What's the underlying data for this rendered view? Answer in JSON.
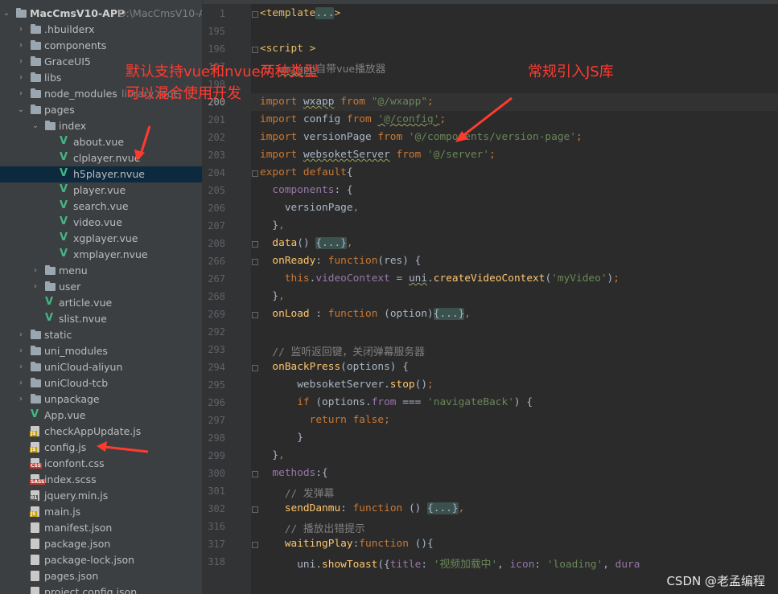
{
  "project": {
    "name": "MacCmsV10-APP",
    "path": "D:\\MacCmsV10-A"
  },
  "tree": [
    {
      "label": "MacCmsV10-APP",
      "type": "root",
      "depth": 0,
      "expanded": true,
      "hint": "D:\\MacCmsV10-A"
    },
    {
      "label": ".hbuilderx",
      "type": "folder",
      "depth": 1,
      "expanded": false
    },
    {
      "label": "components",
      "type": "folder",
      "depth": 1,
      "expanded": false
    },
    {
      "label": "GraceUI5",
      "type": "folder",
      "depth": 1,
      "expanded": false
    },
    {
      "label": "libs",
      "type": "folder",
      "depth": 1,
      "expanded": false
    },
    {
      "label": "node_modules",
      "type": "folder",
      "depth": 1,
      "expanded": false,
      "hint": "library root"
    },
    {
      "label": "pages",
      "type": "folder",
      "depth": 1,
      "expanded": true
    },
    {
      "label": "index",
      "type": "folder",
      "depth": 2,
      "expanded": true
    },
    {
      "label": "about.vue",
      "type": "vue",
      "depth": 3
    },
    {
      "label": "clplayer.nvue",
      "type": "vue",
      "depth": 3
    },
    {
      "label": "h5player.nvue",
      "type": "vue",
      "depth": 3,
      "selected": true
    },
    {
      "label": "player.vue",
      "type": "vue",
      "depth": 3
    },
    {
      "label": "search.vue",
      "type": "vue",
      "depth": 3
    },
    {
      "label": "video.vue",
      "type": "vue",
      "depth": 3
    },
    {
      "label": "xgplayer.vue",
      "type": "vue",
      "depth": 3
    },
    {
      "label": "xmplayer.nvue",
      "type": "vue",
      "depth": 3
    },
    {
      "label": "menu",
      "type": "folder",
      "depth": 2,
      "expanded": false
    },
    {
      "label": "user",
      "type": "folder",
      "depth": 2,
      "expanded": false
    },
    {
      "label": "article.vue",
      "type": "vue",
      "depth": 2
    },
    {
      "label": "slist.nvue",
      "type": "vue",
      "depth": 2
    },
    {
      "label": "static",
      "type": "folder",
      "depth": 1,
      "expanded": false
    },
    {
      "label": "uni_modules",
      "type": "folder",
      "depth": 1,
      "expanded": false
    },
    {
      "label": "uniCloud-aliyun",
      "type": "folder",
      "depth": 1,
      "expanded": false
    },
    {
      "label": "uniCloud-tcb",
      "type": "folder",
      "depth": 1,
      "expanded": false
    },
    {
      "label": "unpackage",
      "type": "folder",
      "depth": 1,
      "expanded": false
    },
    {
      "label": "App.vue",
      "type": "vue",
      "depth": 1
    },
    {
      "label": "checkAppUpdate.js",
      "type": "js",
      "depth": 1
    },
    {
      "label": "config.js",
      "type": "js",
      "depth": 1
    },
    {
      "label": "iconfont.css",
      "type": "css",
      "depth": 1
    },
    {
      "label": "index.scss",
      "type": "sass",
      "depth": 1
    },
    {
      "label": "jquery.min.js",
      "type": "bin",
      "depth": 1
    },
    {
      "label": "main.js",
      "type": "js",
      "depth": 1
    },
    {
      "label": "manifest.json",
      "type": "json",
      "depth": 1
    },
    {
      "label": "package.json",
      "type": "json",
      "depth": 1
    },
    {
      "label": "package-lock.json",
      "type": "json",
      "depth": 1
    },
    {
      "label": "pages.json",
      "type": "json",
      "depth": 1
    },
    {
      "label": "project.config.json",
      "type": "json",
      "depth": 1
    }
  ],
  "editor": {
    "current_line": "200",
    "lines": [
      {
        "n": "1",
        "fold": true,
        "segs": [
          [
            "tag",
            "<template"
          ],
          [
            "fold-text",
            "..."
          ],
          [
            "tag",
            ">"
          ]
        ]
      },
      {
        "n": "195",
        "segs": []
      },
      {
        "n": "196",
        "fold": true,
        "segs": [
          [
            "tag",
            "<script "
          ],
          [
            "tag",
            ">"
          ]
        ]
      },
      {
        "n": "197",
        "segs": [
          [
            "cm",
            "// "
          ],
          [
            "cm squig",
            "uniapp"
          ],
          [
            "cm",
            "自带vue播放器"
          ]
        ]
      },
      {
        "n": "198",
        "segs": []
      },
      {
        "n": "200",
        "segs": [
          [
            "kw",
            "import "
          ],
          [
            "plain squig",
            "wxapp"
          ],
          [
            "kw",
            " from "
          ],
          [
            "str",
            "\"@/wxapp\""
          ],
          [
            "kw",
            ";"
          ]
        ]
      },
      {
        "n": "201",
        "segs": [
          [
            "kw",
            "import "
          ],
          [
            "plain",
            "config"
          ],
          [
            "kw",
            " from "
          ],
          [
            "str squig",
            "'@/config'"
          ],
          [
            "kw",
            ";"
          ]
        ]
      },
      {
        "n": "202",
        "segs": [
          [
            "kw",
            "import "
          ],
          [
            "plain",
            "versionPage"
          ],
          [
            "kw",
            " from "
          ],
          [
            "str",
            "'@/components/version-page'"
          ],
          [
            "kw",
            ";"
          ]
        ]
      },
      {
        "n": "203",
        "segs": [
          [
            "kw",
            "import "
          ],
          [
            "plain squig",
            "websoketServer"
          ],
          [
            "kw",
            " from "
          ],
          [
            "str",
            "'@/server'"
          ],
          [
            "kw",
            ";"
          ]
        ]
      },
      {
        "n": "204",
        "fold": true,
        "segs": [
          [
            "kw",
            "export default"
          ],
          [
            "plain",
            "{"
          ]
        ]
      },
      {
        "n": "205",
        "segs": [
          [
            "prop",
            "  components"
          ],
          [
            "plain",
            ": {"
          ]
        ]
      },
      {
        "n": "206",
        "segs": [
          [
            "plain",
            "    versionPage"
          ],
          [
            "kw",
            ","
          ]
        ]
      },
      {
        "n": "207",
        "segs": [
          [
            "plain",
            "  }"
          ],
          [
            "kw",
            ","
          ]
        ]
      },
      {
        "n": "208",
        "fold": true,
        "segs": [
          [
            "fn",
            "  data"
          ],
          [
            "plain",
            "() "
          ],
          [
            "fold-text",
            "{...}"
          ],
          [
            "kw",
            ","
          ]
        ]
      },
      {
        "n": "266",
        "fold": true,
        "segs": [
          [
            "fn",
            "  onReady"
          ],
          [
            "plain",
            ": "
          ],
          [
            "kw",
            "function"
          ],
          [
            "plain",
            "(res) {"
          ]
        ]
      },
      {
        "n": "267",
        "segs": [
          [
            "kw",
            "    this"
          ],
          [
            "plain",
            "."
          ],
          [
            "prop",
            "videoContext"
          ],
          [
            "plain",
            " = "
          ],
          [
            "plain squig",
            "uni"
          ],
          [
            "plain",
            "."
          ],
          [
            "fn",
            "createVideoContext"
          ],
          [
            "plain",
            "("
          ],
          [
            "str",
            "'myVideo'"
          ],
          [
            "plain",
            ")"
          ],
          [
            "kw",
            ";"
          ]
        ]
      },
      {
        "n": "268",
        "segs": [
          [
            "plain",
            "  }"
          ],
          [
            "kw",
            ","
          ]
        ]
      },
      {
        "n": "269",
        "fold": true,
        "segs": [
          [
            "fn",
            "  onLoad"
          ],
          [
            "plain",
            " : "
          ],
          [
            "kw",
            "function "
          ],
          [
            "plain",
            "(option)"
          ],
          [
            "fold-text",
            "{...}"
          ],
          [
            "kw",
            ","
          ]
        ]
      },
      {
        "n": "292",
        "segs": []
      },
      {
        "n": "293",
        "segs": [
          [
            "cm",
            "  // 监听返回键，关闭弹幕服务器"
          ]
        ]
      },
      {
        "n": "294",
        "fold": true,
        "segs": [
          [
            "fn",
            "  onBackPress"
          ],
          [
            "plain",
            "(options) {"
          ]
        ]
      },
      {
        "n": "295",
        "segs": [
          [
            "plain",
            "      websoketServer."
          ],
          [
            "fn",
            "stop"
          ],
          [
            "plain",
            "()"
          ],
          [
            "kw",
            ";"
          ]
        ]
      },
      {
        "n": "296",
        "segs": [
          [
            "kw",
            "      if "
          ],
          [
            "plain",
            "(options."
          ],
          [
            "prop",
            "from"
          ],
          [
            "plain",
            " === "
          ],
          [
            "str",
            "'navigateBack'"
          ],
          [
            "plain",
            ") {"
          ]
        ]
      },
      {
        "n": "297",
        "segs": [
          [
            "kw",
            "        return false"
          ],
          [
            "kw",
            ";"
          ]
        ]
      },
      {
        "n": "298",
        "segs": [
          [
            "plain",
            "      }"
          ]
        ]
      },
      {
        "n": "299",
        "segs": [
          [
            "plain",
            "  }"
          ],
          [
            "kw",
            ","
          ]
        ]
      },
      {
        "n": "300",
        "fold": true,
        "segs": [
          [
            "prop",
            "  methods"
          ],
          [
            "plain",
            ":{"
          ]
        ]
      },
      {
        "n": "301",
        "segs": [
          [
            "cm",
            "    // 发弹幕"
          ]
        ]
      },
      {
        "n": "302",
        "fold": true,
        "segs": [
          [
            "fn",
            "    sendDanmu"
          ],
          [
            "plain",
            ": "
          ],
          [
            "kw",
            "function "
          ],
          [
            "plain",
            "() "
          ],
          [
            "fold-text",
            "{...}"
          ],
          [
            "kw",
            ","
          ]
        ]
      },
      {
        "n": "316",
        "segs": [
          [
            "cm",
            "    // 播放出错提示"
          ]
        ]
      },
      {
        "n": "317",
        "fold": true,
        "segs": [
          [
            "fn",
            "    waitingPlay"
          ],
          [
            "plain",
            ":"
          ],
          [
            "kw",
            "function "
          ],
          [
            "plain",
            "(){"
          ]
        ]
      },
      {
        "n": "318",
        "segs": [
          [
            "plain",
            "      uni."
          ],
          [
            "fn",
            "showToast"
          ],
          [
            "plain",
            "({"
          ],
          [
            "prop",
            "title"
          ],
          [
            "plain",
            ": "
          ],
          [
            "str",
            "'视频加载中'"
          ],
          [
            "plain",
            ", "
          ],
          [
            "prop",
            "icon"
          ],
          [
            "plain",
            ": "
          ],
          [
            "str",
            "'loading'"
          ],
          [
            "plain",
            ", "
          ],
          [
            "prop",
            "dura"
          ]
        ]
      }
    ]
  },
  "annotations": {
    "left_line1": "默认支持vue和nvue两种类型",
    "left_line2": "可以混合使用开发",
    "right": "常规引入JS库",
    "accent_color": "#ff3b30"
  },
  "watermark": "CSDN @老孟编程"
}
